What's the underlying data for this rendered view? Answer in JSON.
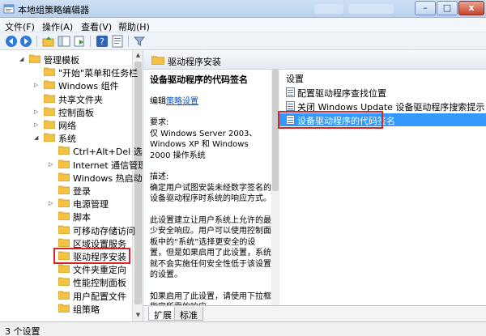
{
  "window": {
    "title": "本地组策略编辑器",
    "controls": {
      "minimize": "–",
      "maximize": "□",
      "close": "x"
    }
  },
  "menu": [
    {
      "label": "文件(F)"
    },
    {
      "label": "操作(A)"
    },
    {
      "label": "查看(V)"
    },
    {
      "label": "帮助(H)"
    }
  ],
  "toolbar": {
    "buttons": [
      "back-arrow-icon",
      "forward-arrow-icon",
      "folder-up-icon",
      "show-hide-tree-icon",
      "export-list-icon",
      "help-icon",
      "properties-icon",
      "filter-icon"
    ]
  },
  "tree": {
    "items": [
      {
        "label": "管理模板",
        "expander": "◢",
        "level": 1
      },
      {
        "label": "\"开始\"菜单和任务栏",
        "expander": "",
        "level": 2
      },
      {
        "label": "Windows 组件",
        "expander": "▷",
        "level": 2
      },
      {
        "label": "共享文件夹",
        "expander": "",
        "level": 2
      },
      {
        "label": "控制面板",
        "expander": "▷",
        "level": 2
      },
      {
        "label": "网络",
        "expander": "▷",
        "level": 2
      },
      {
        "label": "系统",
        "expander": "◢",
        "level": 2
      },
      {
        "label": "Ctrl+Alt+Del 选项",
        "expander": "",
        "level": 3
      },
      {
        "label": "Internet 通信管理",
        "expander": "▷",
        "level": 3
      },
      {
        "label": "Windows 热启动",
        "expander": "",
        "level": 3
      },
      {
        "label": "登录",
        "expander": "",
        "level": 3
      },
      {
        "label": "电源管理",
        "expander": "▷",
        "level": 3
      },
      {
        "label": "脚本",
        "expander": "",
        "level": 3
      },
      {
        "label": "可移动存储访问",
        "expander": "",
        "level": 3
      },
      {
        "label": "区域设置服务",
        "expander": "",
        "level": 3
      },
      {
        "label": "驱动程序安装",
        "expander": "",
        "level": 3
      },
      {
        "label": "文件夹重定向",
        "expander": "",
        "level": 3
      },
      {
        "label": "性能控制面板",
        "expander": "",
        "level": 3
      },
      {
        "label": "用户配置文件",
        "expander": "",
        "level": 3
      },
      {
        "label": "组策略",
        "expander": "",
        "level": 3
      }
    ],
    "highlighted_index": 15
  },
  "pane": {
    "header": "驱动程序安装",
    "description": {
      "title": "设备驱动程序的代码签名",
      "edit_prefix": "编辑",
      "edit_link": "策略设置",
      "requirements_label": "要求:",
      "requirements_text": "仅 Windows Server 2003、Windows XP 和 Windows 2000 操作系统",
      "desc_label": "描述:",
      "desc_text": "确定用户试图安装未经数字签名的设备驱动程序时系统的响应方式。",
      "para2": "此设置建立让用户系统上允许的最少安全响应。用户可以使用控制面板中的“系统”选择更安全的设置，但是如果启用了此设置，系统就不会实施任何安全性低于该设置的设置。",
      "para3": "如果启用了此设置，请使用下拉框指定所需的响应。"
    },
    "list": {
      "column": "设置",
      "items": [
        {
          "label": "配置驱动程序查找位置"
        },
        {
          "label": "关闭 Windows Update 设备驱动程序搜索提示"
        },
        {
          "label": "设备驱动程序的代码签名"
        }
      ],
      "selected_index": 2
    },
    "tabs": [
      {
        "label": "扩展"
      },
      {
        "label": "标准"
      }
    ]
  },
  "status": {
    "text": "3 个设置"
  },
  "colors": {
    "selection": "#3399ff",
    "highlight_box": "#d6262a",
    "link": "#0a53b8"
  }
}
